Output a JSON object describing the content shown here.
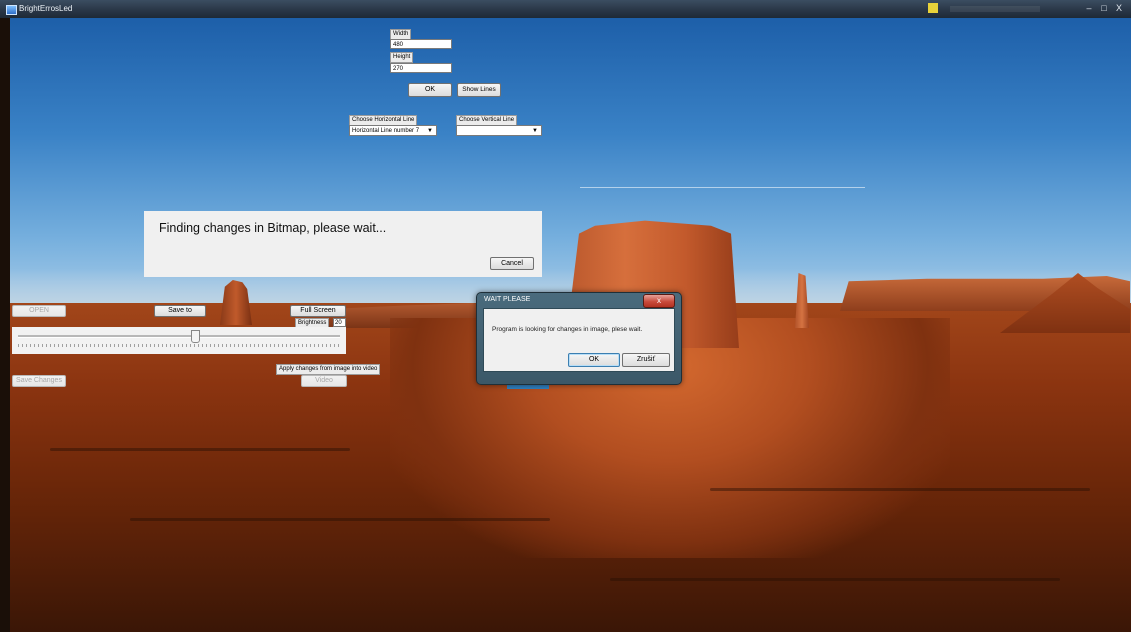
{
  "window": {
    "title": "BrightErrosLed"
  },
  "titlebar_buttons": {
    "minimize": "–",
    "maximize": "□",
    "close": "X"
  },
  "size_form": {
    "width_label": "Width",
    "width_value": "480",
    "height_label": "Height",
    "height_value": "270",
    "ok_label": "OK",
    "show_lines_label": "Show Lines"
  },
  "lines": {
    "horizontal_label": "Choose Horizontal Line",
    "horizontal_value": "Horizontal Line number 7",
    "vertical_label": "Choose Vertical Line",
    "vertical_value": ""
  },
  "progress": {
    "message": "Finding changes in Bitmap, please wait...",
    "cancel_label": "Cancel"
  },
  "toolbar": {
    "open_label": "OPEN",
    "save_to_label": "Save to",
    "full_screen_label": "Full Screen",
    "brightness_label": "Brightness",
    "brightness_value": "20",
    "brightness_slider_fraction": 0.55,
    "apply_changes_label": "Apply changes from image into video",
    "video_label": "Video",
    "save_changes_label": "Save Changes"
  },
  "dialog": {
    "title": "WAIT PLEASE",
    "message": "Program is looking for changes in image, plese wait.",
    "ok_label": "OK",
    "cancel_label": "Zrušiť",
    "close_glyph": "x"
  },
  "colors": {
    "titlebar": "#2a3747",
    "dialog_frame": "#4a6b7d",
    "dialog_close": "#c94b3c",
    "accent_button": "#2f7fbf"
  }
}
